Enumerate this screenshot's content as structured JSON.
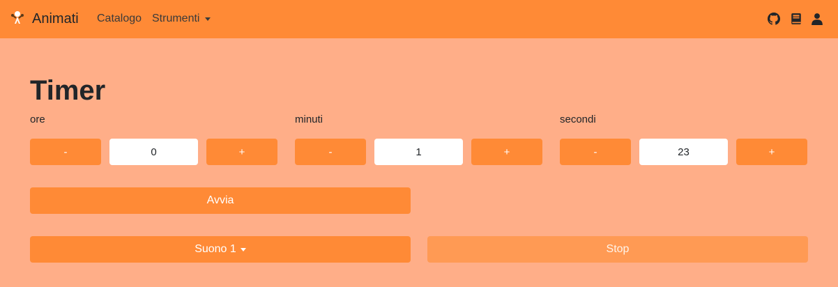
{
  "navbar": {
    "brand": "Animati",
    "links": [
      "Catalogo",
      "Strumenti"
    ],
    "icons": [
      "github-icon",
      "book-icon",
      "user-icon"
    ]
  },
  "page": {
    "title": "Timer"
  },
  "timer": {
    "hours": {
      "label": "ore",
      "value": "0"
    },
    "minutes": {
      "label": "minuti",
      "value": "1"
    },
    "seconds": {
      "label": "secondi",
      "value": "23"
    },
    "decrement_label": "-",
    "increment_label": "+"
  },
  "actions": {
    "start_label": "Avvia",
    "sound_label": "Suono 1",
    "stop_label": "Stop"
  },
  "colors": {
    "navbar": "#ff8a36",
    "background": "#ffae88",
    "button": "#ff8a36",
    "button_disabled": "#ff9a54"
  }
}
